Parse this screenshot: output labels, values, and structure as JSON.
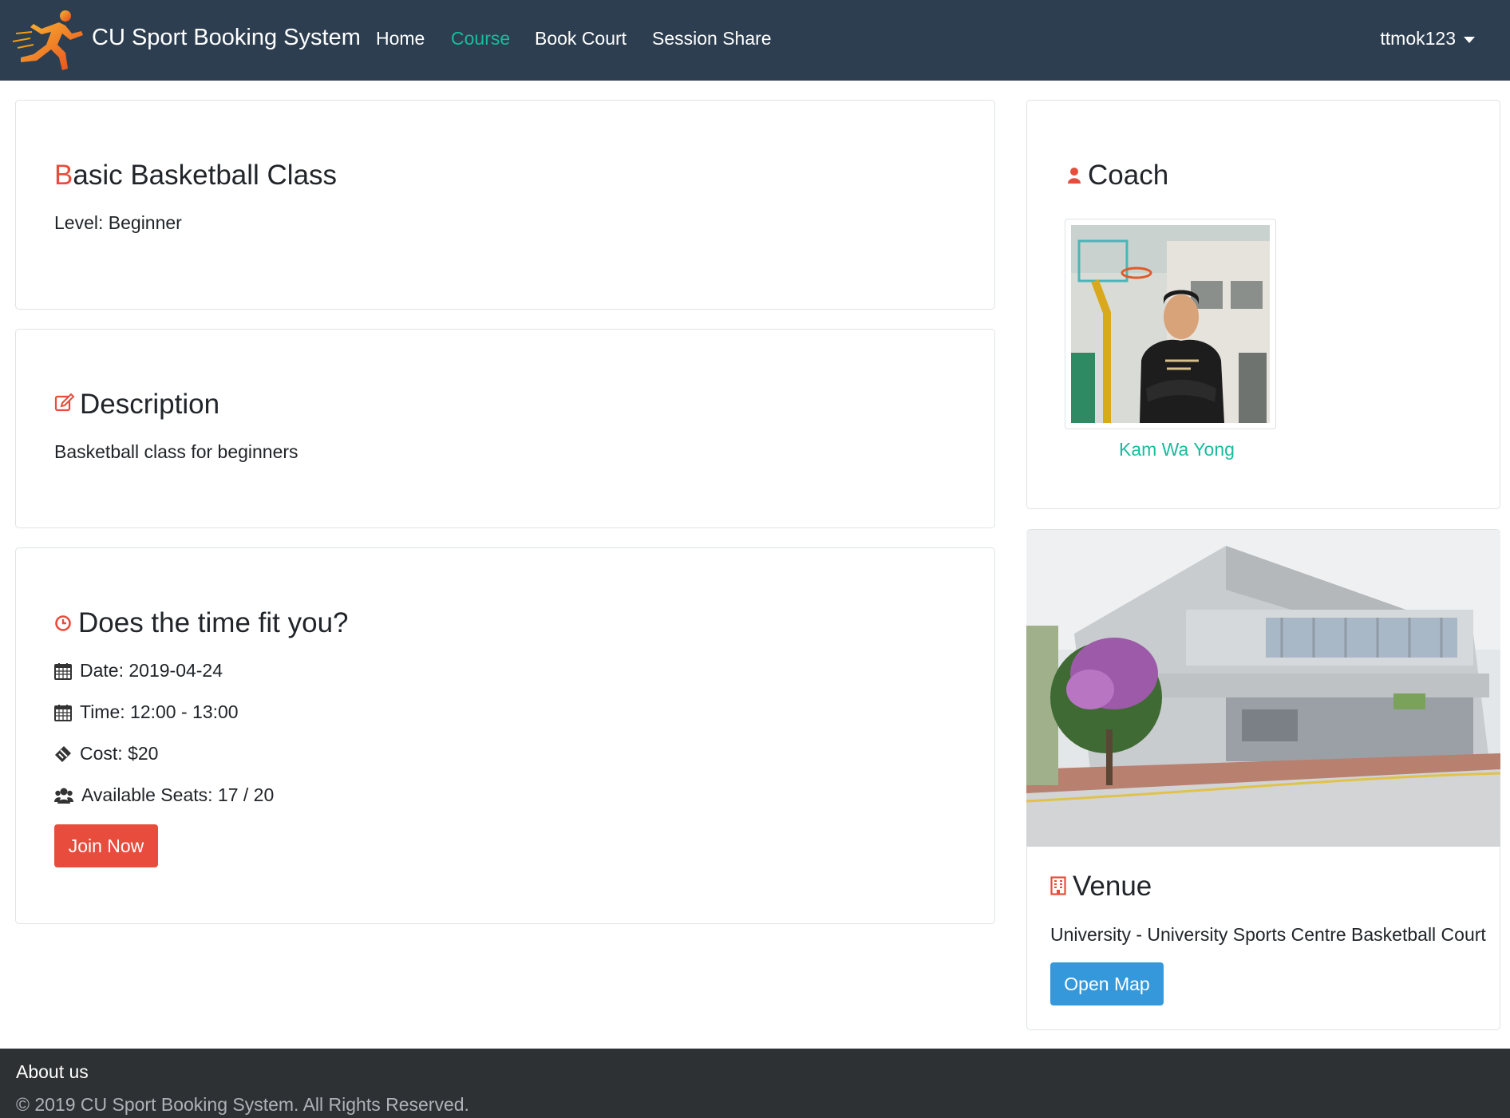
{
  "nav": {
    "brand": "CU Sport Booking System",
    "links": [
      "Home",
      "Course",
      "Book Court",
      "Session Share"
    ],
    "active": "Course",
    "user": "ttmok123"
  },
  "course": {
    "title_first": "B",
    "title_rest": "asic Basketball Class",
    "level": "Level: Beginner"
  },
  "description": {
    "heading": "Description",
    "text": "Basketball class for beginners"
  },
  "time": {
    "heading": "Does the time fit you?",
    "date": "Date: 2019-04-24",
    "time": "Time: 12:00 - 13:00",
    "cost": "Cost: $20",
    "seats": "Available Seats: 17 / 20",
    "join_label": "Join Now"
  },
  "coach": {
    "heading": "Coach",
    "name": "Kam Wa Yong"
  },
  "venue": {
    "heading": "Venue",
    "text": "University - University Sports Centre Basketball Court",
    "map_label": "Open Map"
  },
  "footer": {
    "title": "About us",
    "copyright": "© 2019 CU Sport Booking System. All Rights Reserved."
  },
  "colors": {
    "navbar": "#2c3e50",
    "accent_green": "#18bc9c",
    "accent_red": "#e74c3c",
    "info_blue": "#3498db",
    "footer": "#2e3133"
  },
  "icons": [
    "runner-logo-icon",
    "user-icon",
    "edit-icon",
    "clock-icon",
    "calendar-icon",
    "ticket-icon",
    "users-icon",
    "building-icon",
    "caret-down-icon"
  ]
}
